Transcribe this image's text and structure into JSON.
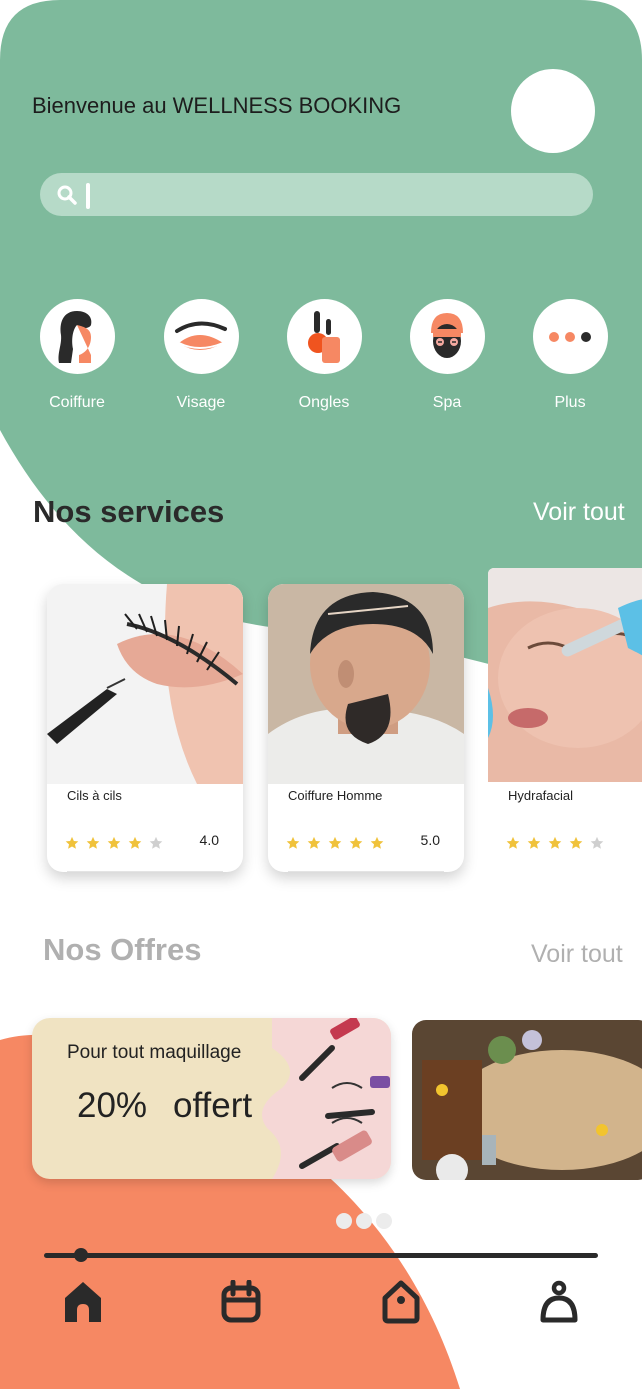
{
  "header": {
    "welcome_text": "Bienvenue au WELLNESS BOOKING"
  },
  "search": {
    "placeholder": ""
  },
  "categories": [
    {
      "label": "Coiffure",
      "icon": "hair-woman-icon"
    },
    {
      "label": "Visage",
      "icon": "eye-lash-icon"
    },
    {
      "label": "Ongles",
      "icon": "nail-polish-icon"
    },
    {
      "label": "Spa",
      "icon": "face-mask-icon"
    },
    {
      "label": "Plus",
      "icon": "more-dots-icon"
    }
  ],
  "services": {
    "title": "Nos services",
    "see_all": "Voir tout",
    "items": [
      {
        "name": "Cils à cils",
        "rating": 4.0,
        "rating_text": "4.0",
        "stars": 4
      },
      {
        "name": "Coiffure Homme",
        "rating": 5.0,
        "rating_text": "5.0",
        "stars": 5
      },
      {
        "name": "Hydrafacial",
        "rating": 4.0,
        "rating_text": "",
        "stars": 4
      }
    ]
  },
  "offers": {
    "title": "Nos Offres",
    "see_all": "Voir tout",
    "items": [
      {
        "subtitle": "Pour tout maquillage",
        "percent": "20%",
        "word": "offert"
      },
      {
        "subtitle": "",
        "percent": "",
        "word": ""
      }
    ],
    "carousel_page": 1,
    "carousel_total": 3
  },
  "nav": {
    "items": [
      {
        "icon": "home-icon"
      },
      {
        "icon": "calendar-icon"
      },
      {
        "icon": "tag-icon"
      },
      {
        "icon": "profile-icon"
      }
    ],
    "slider_position": 0.06
  },
  "colors": {
    "primary_green": "#7eba9c",
    "accent_orange": "#f68863",
    "star": "#f0c23b",
    "star_empty": "#cfcfcf",
    "dark": "#2a2a2a"
  }
}
